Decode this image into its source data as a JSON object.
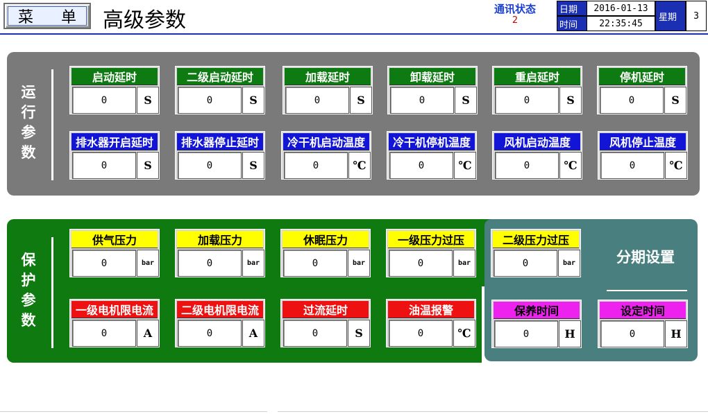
{
  "header": {
    "menu_chars": [
      "菜",
      "单"
    ],
    "title": "高级参数",
    "comm_label": "通讯状态",
    "comm_value": "2",
    "date_label": "日期",
    "date_value": "2016-01-13",
    "time_label": "时间",
    "time_value": "22:35:45",
    "weekday_label": "星期",
    "weekday_value": "3"
  },
  "run_section": {
    "title": [
      "运",
      "行",
      "参",
      "数"
    ],
    "params": [
      {
        "label": "启动延时",
        "value": "0",
        "unit": "S"
      },
      {
        "label": "二级启动延时",
        "value": "0",
        "unit": "S"
      },
      {
        "label": "加载延时",
        "value": "0",
        "unit": "S"
      },
      {
        "label": "卸载延时",
        "value": "0",
        "unit": "S"
      },
      {
        "label": "重启延时",
        "value": "0",
        "unit": "S"
      },
      {
        "label": "停机延时",
        "value": "0",
        "unit": "S"
      },
      {
        "label": "排水器开启延时",
        "value": "0",
        "unit": "S"
      },
      {
        "label": "排水器停止延时",
        "value": "0",
        "unit": "S"
      },
      {
        "label": "冷干机启动温度",
        "value": "0",
        "unit": "℃"
      },
      {
        "label": "冷干机停机温度",
        "value": "0",
        "unit": "℃"
      },
      {
        "label": "风机启动温度",
        "value": "0",
        "unit": "℃"
      },
      {
        "label": "风机停止温度",
        "value": "0",
        "unit": "℃"
      }
    ]
  },
  "protect_section": {
    "title": [
      "保",
      "护",
      "参",
      "数"
    ],
    "params": [
      {
        "label": "供气压力",
        "value": "0",
        "unit": "bar"
      },
      {
        "label": "加载压力",
        "value": "0",
        "unit": "bar"
      },
      {
        "label": "休眠压力",
        "value": "0",
        "unit": "bar"
      },
      {
        "label": "一级压力过压",
        "value": "0",
        "unit": "bar"
      },
      {
        "label": "二级压力过压",
        "value": "0",
        "unit": "bar"
      },
      {
        "label": "一级电机限电流",
        "value": "0",
        "unit": "A"
      },
      {
        "label": "二级电机限电流",
        "value": "0",
        "unit": "A"
      },
      {
        "label": "过流延时",
        "value": "0",
        "unit": "S"
      },
      {
        "label": "油温报警",
        "value": "0",
        "unit": "℃"
      }
    ]
  },
  "stage_section": {
    "title": "分期设置",
    "params": [
      {
        "label": "保养时间",
        "value": "0",
        "unit": "H"
      },
      {
        "label": "设定时间",
        "value": "0",
        "unit": "H"
      }
    ]
  },
  "colors": {
    "run_panel": "#7a7a7a",
    "protect_panel": "#0f7a0f",
    "stage_panel": "#4a7f7f",
    "green_header": "#0e7a12",
    "blue_header": "#1214d6",
    "yellow_header": "#ffff00",
    "red_header": "#ee1111",
    "magenta_header": "#ee22ee"
  }
}
